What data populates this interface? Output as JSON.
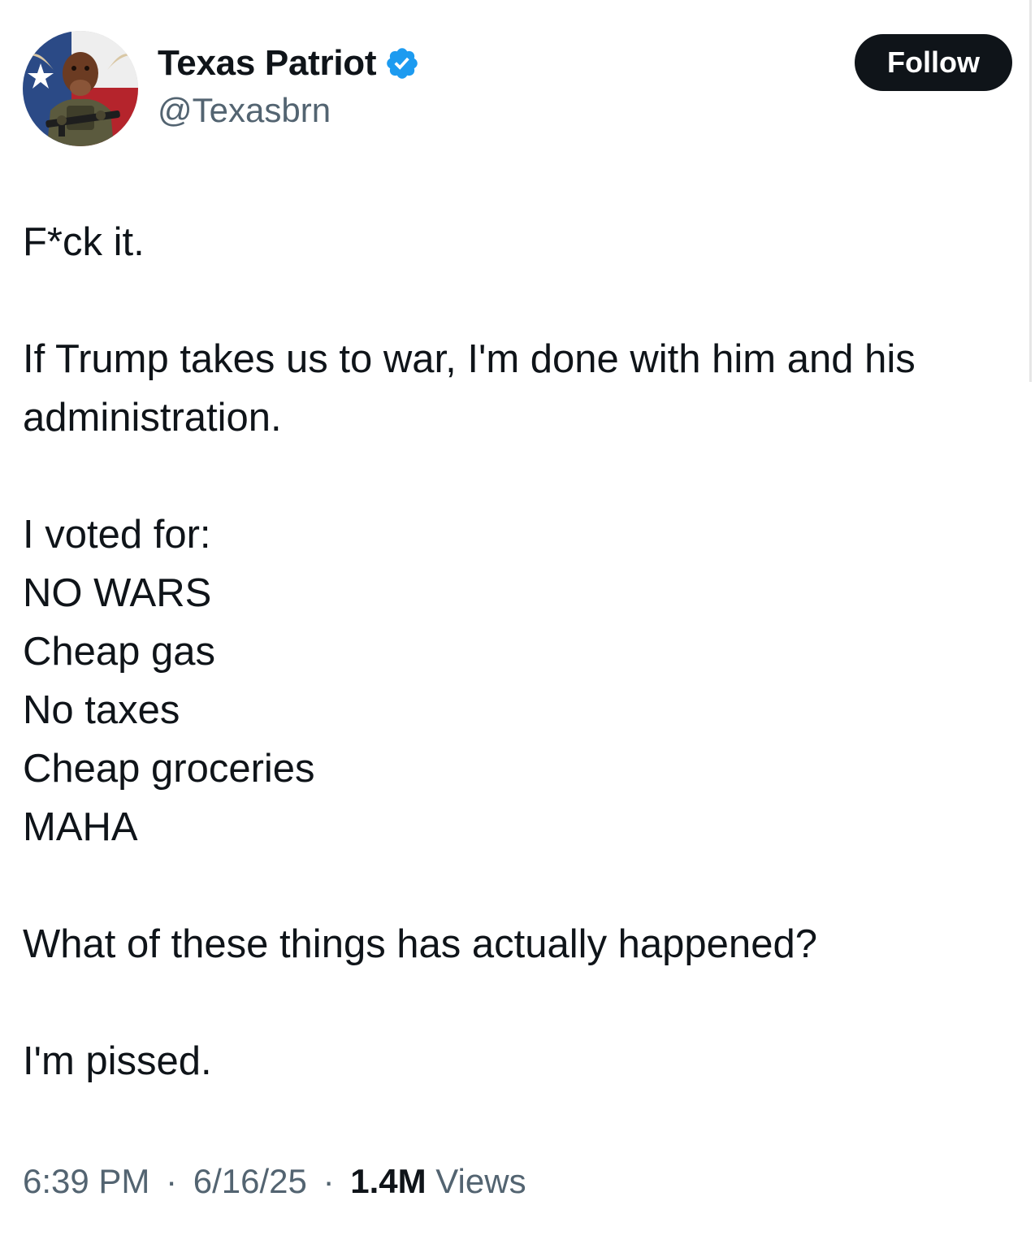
{
  "author": {
    "display_name": "Texas Patriot",
    "handle": "@Texasbrn",
    "verified": true,
    "avatar_icon": "bull-soldier-avatar"
  },
  "follow_button": {
    "label": "Follow"
  },
  "tweet": {
    "paragraphs": [
      [
        "F*ck it."
      ],
      [
        "If Trump takes us to war, I'm done with him and his",
        "administration."
      ],
      [
        "I voted for:",
        "NO WARS",
        "Cheap gas",
        "No taxes",
        "Cheap groceries",
        "MAHA"
      ],
      [
        "What of these things has actually happened?"
      ],
      [
        "I'm pissed."
      ]
    ]
  },
  "meta": {
    "time": "6:39 PM",
    "date": "6/16/25",
    "views_count": "1.4M",
    "views_label": "Views",
    "separator": "·"
  },
  "colors": {
    "text_primary": "#0f1419",
    "text_secondary": "#536471",
    "verified_blue": "#1d9bf0",
    "button_bg": "#0f1419",
    "button_text": "#ffffff"
  }
}
